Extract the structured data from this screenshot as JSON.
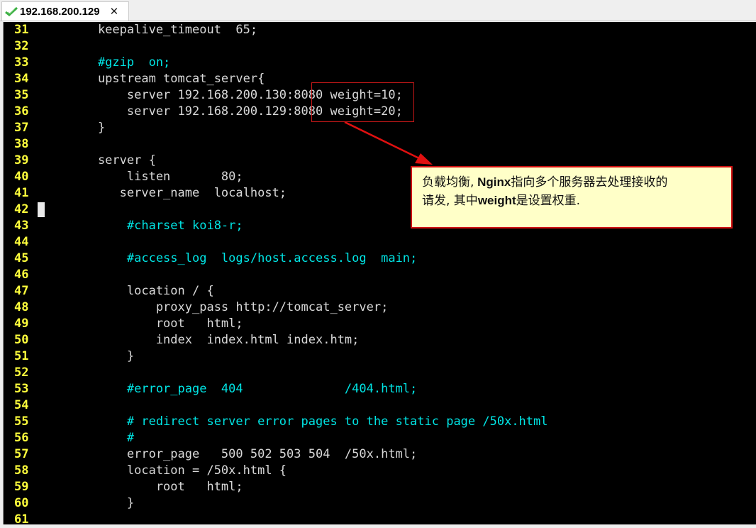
{
  "tab": {
    "title": "192.168.200.129",
    "status_icon": "check-icon",
    "close_glyph": "✕",
    "status_color": "#3cb043"
  },
  "editor": {
    "lines": [
      {
        "n": "31",
        "text": "    keepalive_timeout  65;",
        "kind": "code"
      },
      {
        "n": "32",
        "text": "",
        "kind": "code"
      },
      {
        "n": "33",
        "text": "    #gzip  on;",
        "kind": "comment"
      },
      {
        "n": "34",
        "text": "    upstream tomcat_server{",
        "kind": "code"
      },
      {
        "n": "35",
        "text": "        server 192.168.200.130:8080 weight=10;",
        "kind": "code"
      },
      {
        "n": "36",
        "text": "        server 192.168.200.129:8080 weight=20;",
        "kind": "code"
      },
      {
        "n": "37",
        "text": "    }",
        "kind": "code"
      },
      {
        "n": "38",
        "text": "",
        "kind": "code"
      },
      {
        "n": "39",
        "text": "    server {",
        "kind": "code"
      },
      {
        "n": "40",
        "text": "        listen       80;",
        "kind": "code"
      },
      {
        "n": "41",
        "text": "       server_name  localhost;",
        "kind": "code"
      },
      {
        "n": "42",
        "text": "",
        "kind": "code"
      },
      {
        "n": "43",
        "text": "        #charset koi8-r;",
        "kind": "comment"
      },
      {
        "n": "44",
        "text": "",
        "kind": "code"
      },
      {
        "n": "45",
        "text": "        #access_log  logs/host.access.log  main;",
        "kind": "comment"
      },
      {
        "n": "46",
        "text": "",
        "kind": "code"
      },
      {
        "n": "47",
        "text": "        location / {",
        "kind": "code"
      },
      {
        "n": "48",
        "text": "            proxy_pass http://tomcat_server;",
        "kind": "code"
      },
      {
        "n": "49",
        "text": "            root   html;",
        "kind": "code"
      },
      {
        "n": "50",
        "text": "            index  index.html index.htm;",
        "kind": "code"
      },
      {
        "n": "51",
        "text": "        }",
        "kind": "code"
      },
      {
        "n": "52",
        "text": "",
        "kind": "code"
      },
      {
        "n": "53",
        "text": "        #error_page  404              /404.html;",
        "kind": "comment"
      },
      {
        "n": "54",
        "text": "",
        "kind": "code"
      },
      {
        "n": "55",
        "text": "        # redirect server error pages to the static page /50x.html",
        "kind": "comment"
      },
      {
        "n": "56",
        "text": "        #",
        "kind": "comment"
      },
      {
        "n": "57",
        "text": "        error_page   500 502 503 504  /50x.html;",
        "kind": "code"
      },
      {
        "n": "58",
        "text": "        location = /50x.html {",
        "kind": "code"
      },
      {
        "n": "59",
        "text": "            root   html;",
        "kind": "code"
      },
      {
        "n": "60",
        "text": "        }",
        "kind": "code"
      },
      {
        "n": "61",
        "text": "",
        "kind": "code"
      }
    ],
    "cursor_line": "42",
    "colors": {
      "line_number": "#ffff3c",
      "code": "#d8d8d8",
      "comment": "#00e5e5",
      "background": "#000000"
    }
  },
  "annotation": {
    "callout_line1_a": "负载均衡,",
    "callout_line1_b": " Nginx",
    "callout_line1_c": "指向多个服务器去处理接收的",
    "callout_line2_a": "请发, 其中",
    "callout_line2_b": "weight",
    "callout_line2_c": "是设置权重.",
    "border_color": "#d01010",
    "background_color": "#ffffc8"
  }
}
